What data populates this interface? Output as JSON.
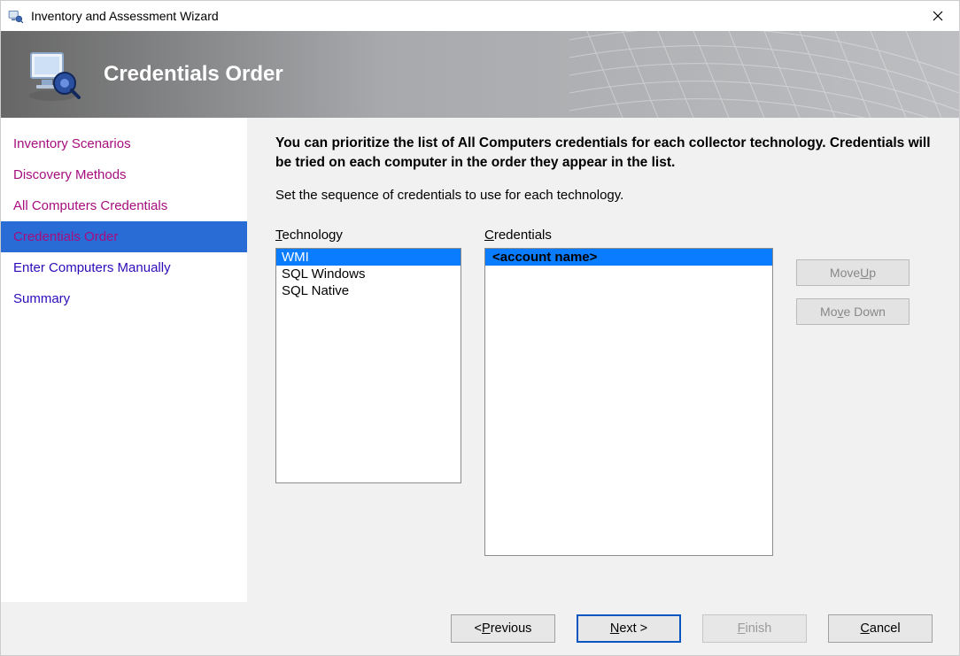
{
  "window": {
    "title": "Inventory and Assessment Wizard"
  },
  "banner": {
    "title": "Credentials Order"
  },
  "sidebar": {
    "items": [
      {
        "label": "Inventory Scenarios",
        "state": "visited"
      },
      {
        "label": "Discovery Methods",
        "state": "visited"
      },
      {
        "label": "All Computers Credentials",
        "state": "visited"
      },
      {
        "label": "Credentials Order",
        "state": "selected"
      },
      {
        "label": "Enter Computers Manually",
        "state": "normal"
      },
      {
        "label": "Summary",
        "state": "normal"
      }
    ]
  },
  "content": {
    "heading": "You can prioritize the list of All Computers credentials for each collector technology. Credentials will be tried on each computer in the order they appear in the list.",
    "subheading": "Set the sequence of credentials to use for each technology.",
    "tech_label_pre": "T",
    "tech_label_rest": "echnology",
    "cred_label_pre": "C",
    "cred_label_rest": "redentials",
    "technology": {
      "items": [
        "WMI",
        "SQL Windows",
        "SQL Native"
      ],
      "selected_index": 0
    },
    "credentials": {
      "items": [
        "<account name>"
      ],
      "selected_index": 0
    },
    "move_up_pre": "Move ",
    "move_up_ul": "U",
    "move_up_post": "p",
    "move_down_pre": "Mo",
    "move_down_ul": "v",
    "move_down_post": "e Down"
  },
  "footer": {
    "prev_pre": "< ",
    "prev_ul": "P",
    "prev_post": "revious",
    "next_ul": "N",
    "next_post": "ext >",
    "finish_ul": "F",
    "finish_post": "inish",
    "cancel_pre": "",
    "cancel_ul": "C",
    "cancel_post": "ancel"
  }
}
